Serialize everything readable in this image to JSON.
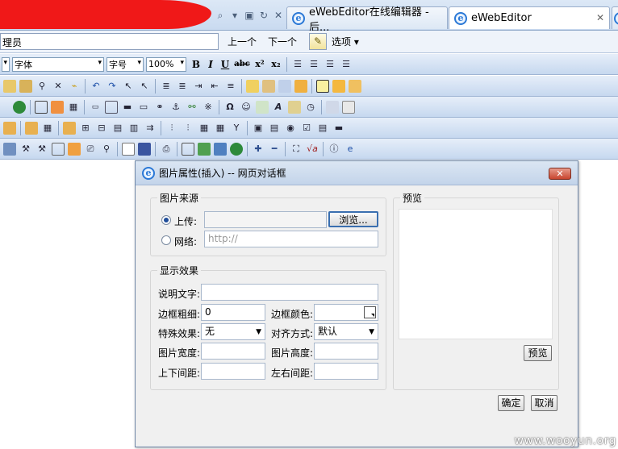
{
  "browser": {
    "tabs": [
      {
        "title": "eWebEditor在线编辑器 - 后...",
        "active": false
      },
      {
        "title": "eWebEditor",
        "active": true
      }
    ],
    "find_text": "理员",
    "prev_label": "上一个",
    "next_label": "下一个",
    "options_label": "选项"
  },
  "toolbar": {
    "font_select": "字体",
    "size_select": "字号",
    "zoom_select": "100%",
    "bold": "B",
    "italic": "I",
    "underline": "U",
    "strike": "abc",
    "superscript": "x²",
    "subscript": "x₂"
  },
  "dialog": {
    "title": "图片属性(插入) -- 网页对话框",
    "source_group": "图片来源",
    "upload_label": "上传:",
    "browse_button": "浏览...",
    "web_label": "网络:",
    "web_placeholder": "http://",
    "effect_group": "显示效果",
    "desc_label": "说明文字:",
    "border_width_label": "边框粗细:",
    "border_width_value": "0",
    "border_color_label": "边框颜色:",
    "special_effect_label": "特殊效果:",
    "special_effect_value": "无",
    "align_label": "对齐方式:",
    "align_value": "默认",
    "width_label": "图片宽度:",
    "height_label": "图片高度:",
    "vspace_label": "上下间距:",
    "hspace_label": "左右间距:",
    "preview_group": "预览",
    "preview_button": "预览",
    "ok_button": "确定",
    "cancel_button": "取消"
  },
  "watermark": "www.wooyun.org",
  "colors": {
    "redaction": "#f01818",
    "toolbar_bg": "#c6d8ef",
    "dialog_bg": "#f0f0f0"
  }
}
